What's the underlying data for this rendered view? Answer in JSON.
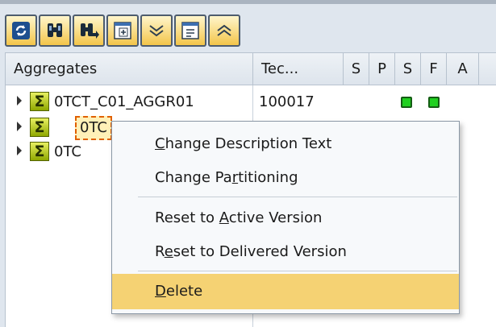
{
  "toolbar": {
    "buttons": [
      {
        "icon": "refresh-icon"
      },
      {
        "icon": "find-icon"
      },
      {
        "icon": "find-next-icon"
      },
      {
        "icon": "expand-all-icon"
      },
      {
        "icon": "expand-subtree-icon"
      },
      {
        "icon": "collapse-all-icon"
      },
      {
        "icon": "collapse-subtree-icon"
      }
    ]
  },
  "grid": {
    "headers": {
      "aggregates": "Aggregates",
      "tech": "Tec...",
      "s1": "S",
      "p": "P",
      "s2": "S",
      "f": "F",
      "a": "A"
    },
    "rows": [
      {
        "name": "0TCT_C01_AGGR01",
        "tech": "100017",
        "status_color": "#20d020"
      },
      {
        "name": "0TC",
        "tech": ""
      },
      {
        "name": "0TC",
        "tech": ""
      }
    ]
  },
  "context_menu": {
    "items": [
      {
        "label": "Change Description Text",
        "hotkey": "C"
      },
      {
        "label": "Change Partitioning",
        "hotkey": "r"
      },
      {
        "label": "Reset to Active Version",
        "hotkey": "A"
      },
      {
        "label": "Reset to Delivered Version",
        "hotkey": "e"
      },
      {
        "label": "Delete",
        "hotkey": "D",
        "highlighted": true
      }
    ],
    "highlight_color": "#f5d273"
  }
}
